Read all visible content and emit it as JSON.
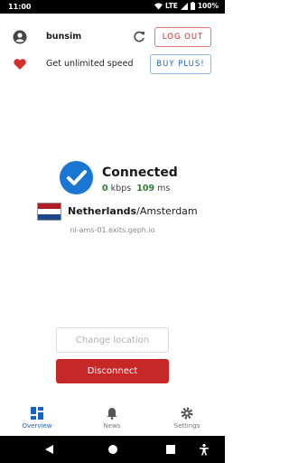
{
  "status_bar": {
    "time": "11:00",
    "network": "LTE",
    "battery": "100%"
  },
  "account": {
    "username": "bunsim",
    "logout_label": "LOG OUT"
  },
  "promo": {
    "text": "Get unlimited speed",
    "button_label": "BUY PLUS!"
  },
  "connection": {
    "status": "Connected",
    "download_value": "0",
    "download_unit": "kbps",
    "ping_value": "109",
    "ping_unit": "ms",
    "country": "Netherlands",
    "separator": "/",
    "city": "Amsterdam",
    "exit_host": "nl-ams-01.exits.geph.io"
  },
  "actions": {
    "change_location_label": "Change location",
    "disconnect_label": "Disconnect"
  },
  "bottom_nav": {
    "items": [
      {
        "label": "Overview",
        "icon": "dashboard-icon",
        "active": true
      },
      {
        "label": "News",
        "icon": "bell-icon",
        "active": false
      },
      {
        "label": "Settings",
        "icon": "gear-icon",
        "active": false
      }
    ]
  },
  "colors": {
    "accent_blue": "#1565c0",
    "danger_red": "#c62828",
    "ok_green": "#2e7d32"
  }
}
